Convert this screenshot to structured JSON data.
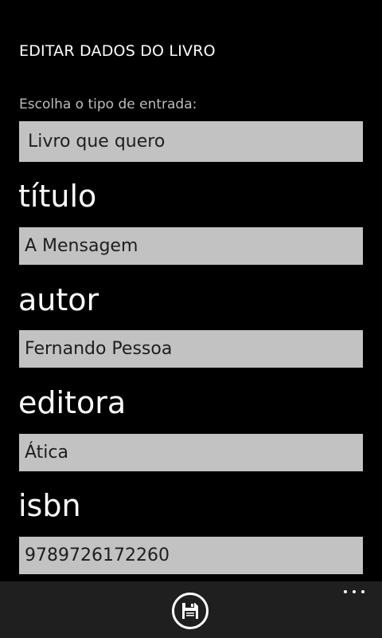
{
  "page": {
    "title": "EDITAR DADOS DO LIVRO"
  },
  "entry_type": {
    "label": "Escolha o tipo de entrada:",
    "selected": "Livro que quero"
  },
  "fields": {
    "titulo": {
      "label": "título",
      "value": "A Mensagem"
    },
    "autor": {
      "label": "autor",
      "value": "Fernando Pessoa"
    },
    "editora": {
      "label": "editora",
      "value": "Ática"
    },
    "isbn": {
      "label": "isbn",
      "value": "9789726172260"
    }
  },
  "app_bar": {
    "primary_icon": "save-icon",
    "overflow_icon": "more-icon"
  },
  "colors": {
    "background": "#000000",
    "field_background": "#c2c2c2",
    "field_text": "#1e1e1e",
    "app_bar": "#1f1f1f"
  }
}
